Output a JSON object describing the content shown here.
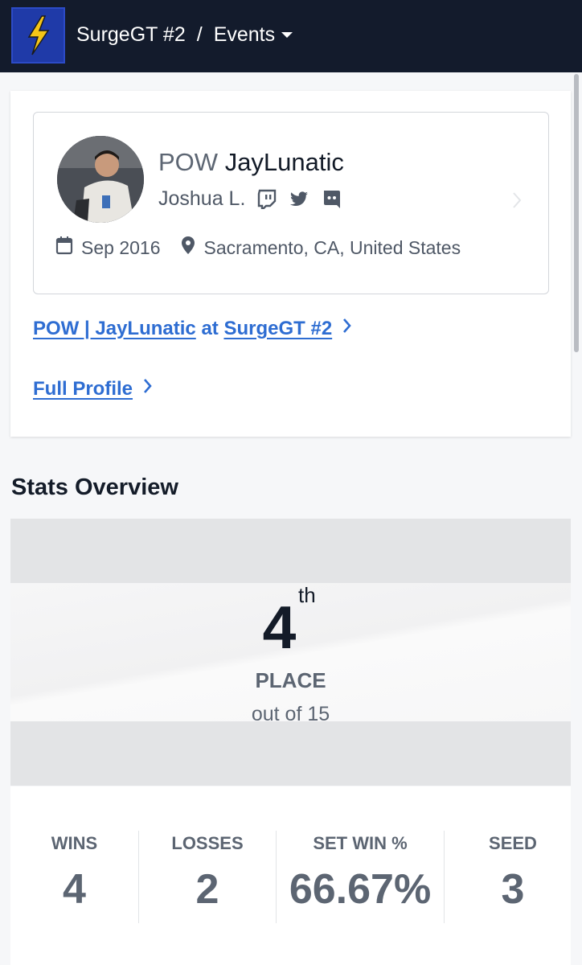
{
  "header": {
    "event_name": "SurgeGT #2",
    "separator": "/",
    "section": "Events",
    "colors": {
      "bar": "#131b2c",
      "logo_bg": "#1f3aa8",
      "bolt": "#f5c518"
    }
  },
  "profile": {
    "prefix": "POW",
    "gamertag": "JayLunatic",
    "real_name": "Joshua L.",
    "socials": [
      "twitch-icon",
      "twitter-icon",
      "discord-icon"
    ],
    "joined": "Sep 2016",
    "location": "Sacramento, CA, United States"
  },
  "links": {
    "entrant_name": "POW | JayLunatic",
    "entrant_at": "at",
    "entrant_event": "SurgeGT #2",
    "full_profile": "Full Profile",
    "color": "#2e6dd2"
  },
  "stats": {
    "title": "Stats Overview",
    "place": "4",
    "place_suffix": "th",
    "place_label": "PLACE",
    "place_sub": "out of 15",
    "items": [
      {
        "label": "WINS",
        "value": "4"
      },
      {
        "label": "LOSSES",
        "value": "2"
      },
      {
        "label": "SET WIN %",
        "value": "66.67%"
      },
      {
        "label": "SEED",
        "value": "3"
      }
    ]
  }
}
